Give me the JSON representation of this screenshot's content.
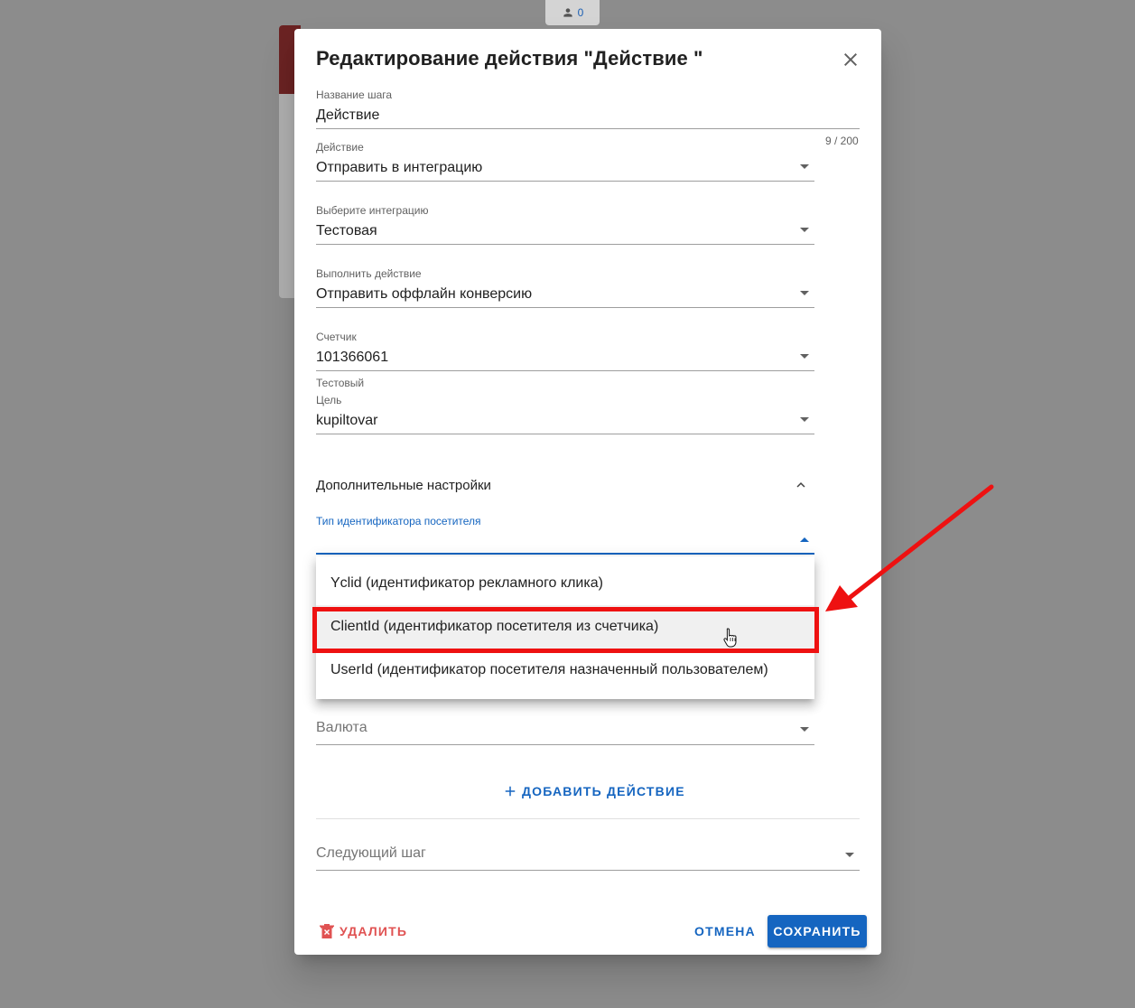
{
  "background": {
    "user_count": "0"
  },
  "dialog": {
    "title": "Редактирование действия \"Действие \"",
    "step_name": {
      "label": "Название шага",
      "value": "Действие",
      "counter": "9 / 200"
    },
    "action": {
      "label": "Действие",
      "value": "Отправить в интеграцию"
    },
    "integration": {
      "label": "Выберите интеграцию",
      "value": "Тестовая"
    },
    "perform_action": {
      "label": "Выполнить действие",
      "value": "Отправить оффлайн конверсию"
    },
    "counter_field": {
      "label": "Счетчик",
      "value": "101366061",
      "hint": "Тестовый"
    },
    "goal": {
      "label": "Цель",
      "value": "kupiltovar"
    },
    "advanced_settings": {
      "label": "Дополнительные настройки"
    },
    "visitor_id_type": {
      "label": "Тип идентификатора посетителя",
      "options": [
        "Yclid (идентификатор рекламного клика)",
        "ClientId (идентификатор посетителя из счетчика)",
        "UserId (идентификатор посетителя назначенный пользователем)"
      ],
      "hovered_index": 1
    },
    "currency": {
      "placeholder": "Валюта"
    },
    "add_action_label": "ДОБАВИТЬ ДЕЙСТВИЕ",
    "next_step": {
      "placeholder": "Следующий шаг"
    },
    "buttons": {
      "delete": "УДАЛИТЬ",
      "cancel": "ОТМЕНА",
      "save": "СОХРАНИТЬ"
    }
  },
  "colors": {
    "primary": "#1565c0",
    "danger": "#e05252",
    "annotation": "#ee1111"
  },
  "icons": [
    "person-icon",
    "close-icon",
    "dropdown-caret-icon",
    "chevron-up-icon",
    "plus-icon",
    "trash-icon",
    "hand-cursor-icon",
    "arrow-annotation"
  ]
}
